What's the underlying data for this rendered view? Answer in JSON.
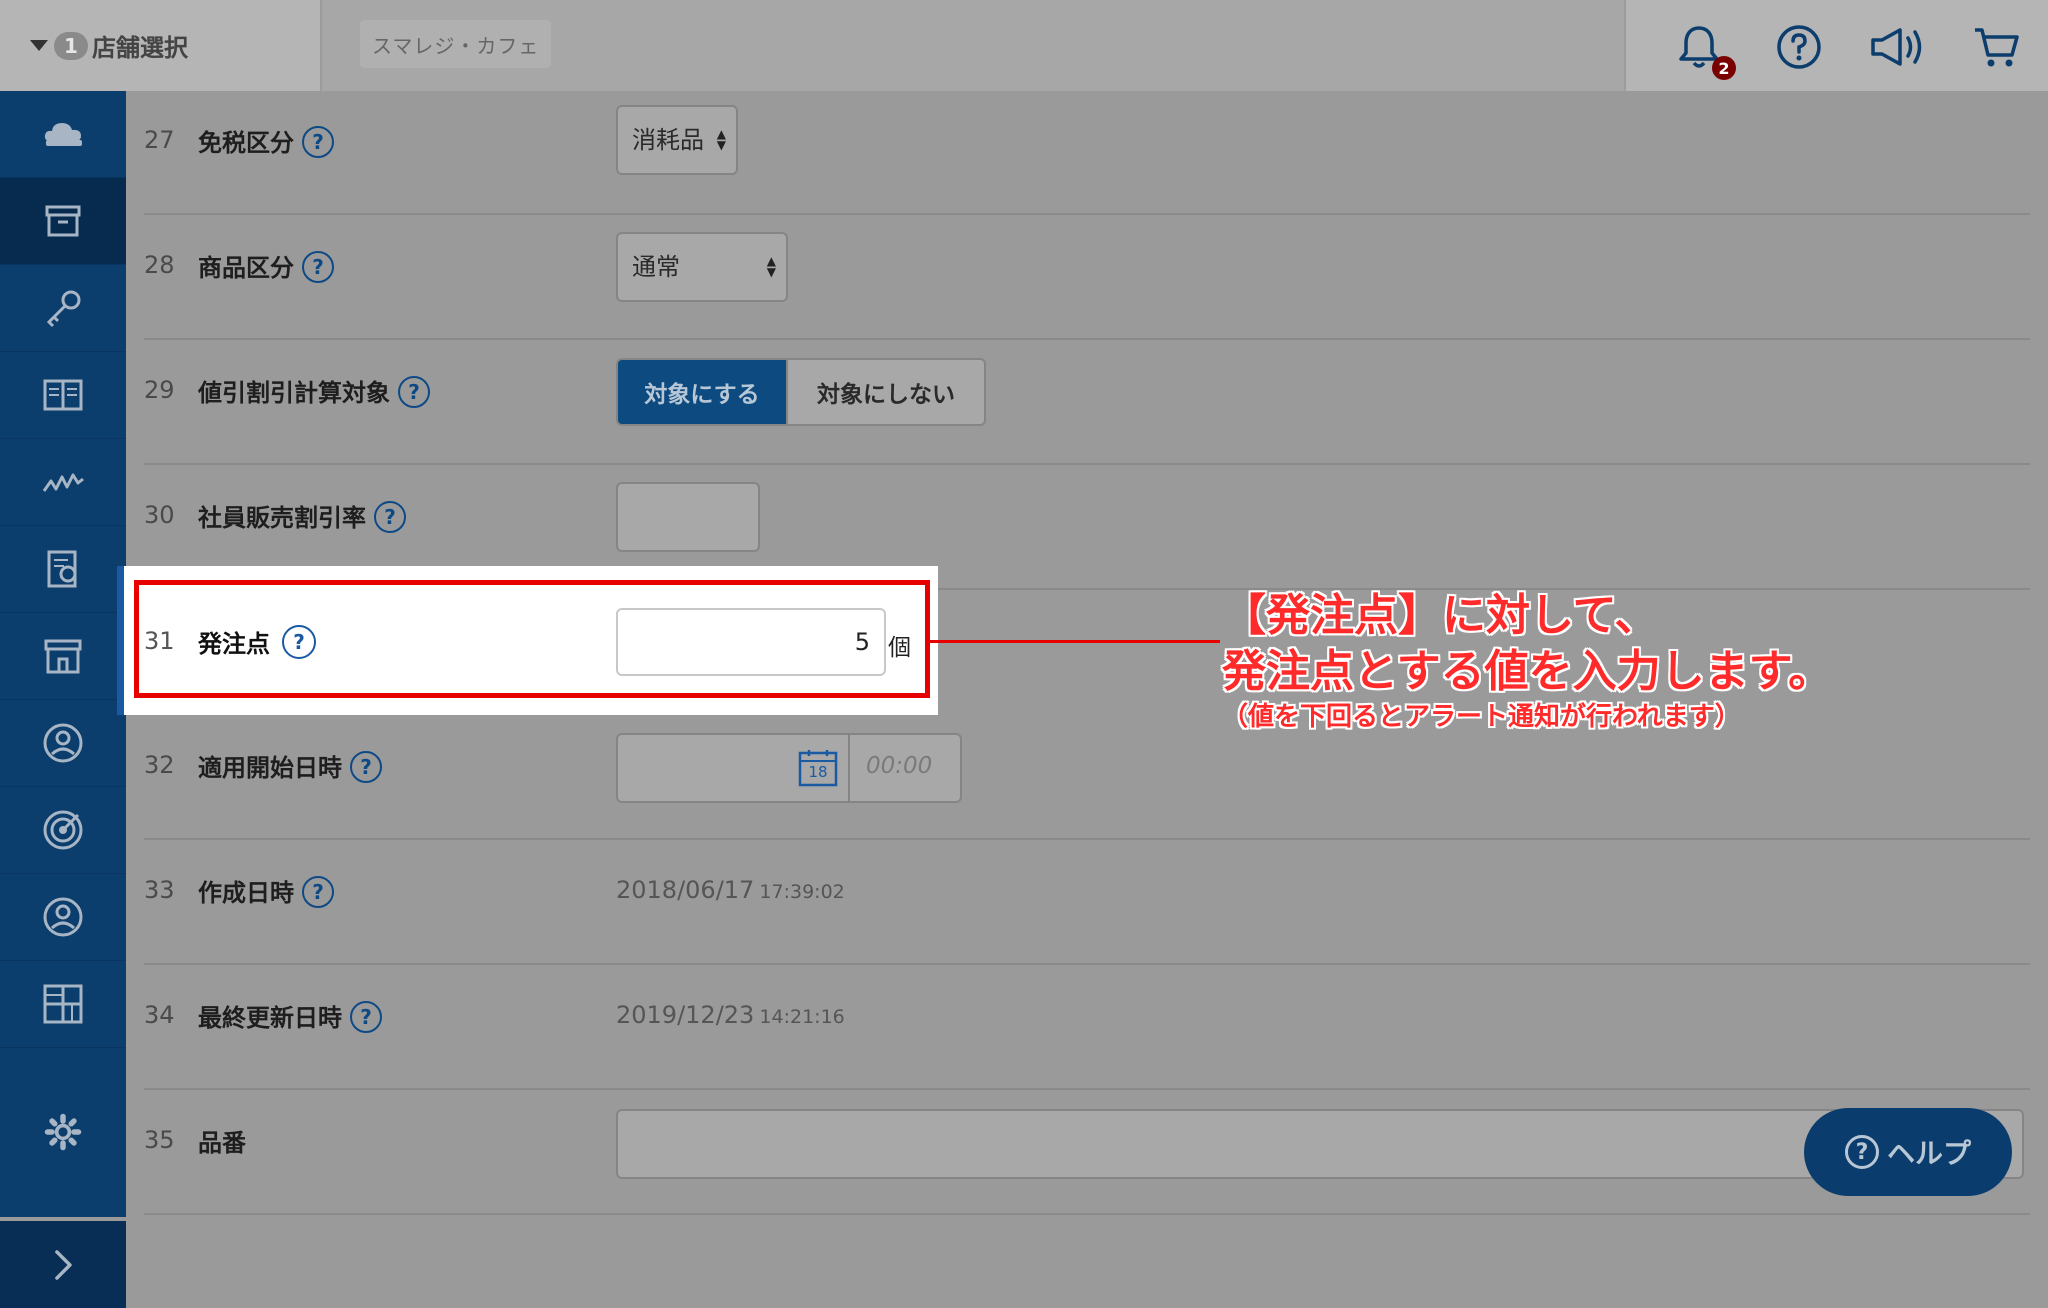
{
  "header": {
    "store_select_label": "店舗選択",
    "store_select_count": "1",
    "store_name": "スマレジ・カフェ",
    "notification_count": "2"
  },
  "rows": [
    {
      "num": "27",
      "label": "免税区分",
      "select_value": "消耗品"
    },
    {
      "num": "28",
      "label": "商品区分",
      "select_value": "通常"
    },
    {
      "num": "29",
      "label": "値引割引計算対象",
      "toggle_on": "対象にする",
      "toggle_off": "対象にしない"
    },
    {
      "num": "30",
      "label": "社員販売割引率"
    },
    {
      "num": "31",
      "label": "発注点",
      "value": "5",
      "unit": "個"
    },
    {
      "num": "32",
      "label": "適用開始日時",
      "calendar_day": "18",
      "time_placeholder": "00:00"
    },
    {
      "num": "33",
      "label": "作成日時",
      "date": "2018/06/17",
      "time": "17:39:02"
    },
    {
      "num": "34",
      "label": "最終更新日時",
      "date": "2019/12/23",
      "time": "14:21:16"
    },
    {
      "num": "35",
      "label": "品番"
    }
  ],
  "annotation": {
    "line1": "【発注点】に対して、",
    "line2": "発注点とする値を入力します。",
    "line3": "（値を下回るとアラート通知が行われます）"
  },
  "help_button": "ヘルプ",
  "colors": {
    "sidebar": "#0b3d6d",
    "accent": "#0c4a80",
    "annotation_red": "#e60000"
  },
  "sidebar_icons": [
    "cloud-icon",
    "archive-box-icon",
    "key-icon",
    "book-icon",
    "chart-line-icon",
    "report-icon",
    "store-icon",
    "user-circle-icon",
    "target-icon",
    "person-icon",
    "grid-icon",
    "gear-icon",
    "chevron-right-icon"
  ]
}
